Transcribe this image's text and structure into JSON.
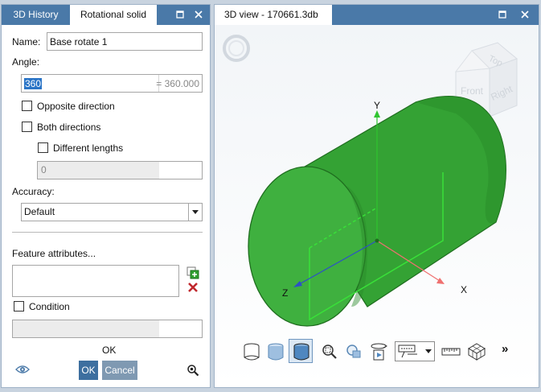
{
  "left_panel": {
    "tabs": [
      {
        "label": "3D History"
      },
      {
        "label": "Rotational solid"
      }
    ],
    "name_label": "Name:",
    "name_value": "Base rotate 1",
    "angle_label": "Angle:",
    "angle_value": "360",
    "angle_result": "= 360.000",
    "opposite_direction_label": "Opposite direction",
    "both_directions_label": "Both directions",
    "different_lengths_label": "Different lengths",
    "length_value": "0",
    "accuracy_label": "Accuracy:",
    "accuracy_value": "Default",
    "feature_attributes_label": "Feature attributes...",
    "condition_label": "Condition",
    "ok_text": "OK",
    "ok_button": "OK",
    "cancel_button": "Cancel"
  },
  "view": {
    "tab_title": "3D view - 170661.3db",
    "viewcube": {
      "top": "Top",
      "front": "Front",
      "right": "Right"
    },
    "axes": {
      "x": "X",
      "y": "Y",
      "z": "Z"
    },
    "toolbar_more": "»"
  },
  "colors": {
    "accent": "#4a79a8",
    "solid_green": "#2f9e2f",
    "ok_button": "#3d6f9f",
    "cancel_button": "#7f99b2"
  }
}
